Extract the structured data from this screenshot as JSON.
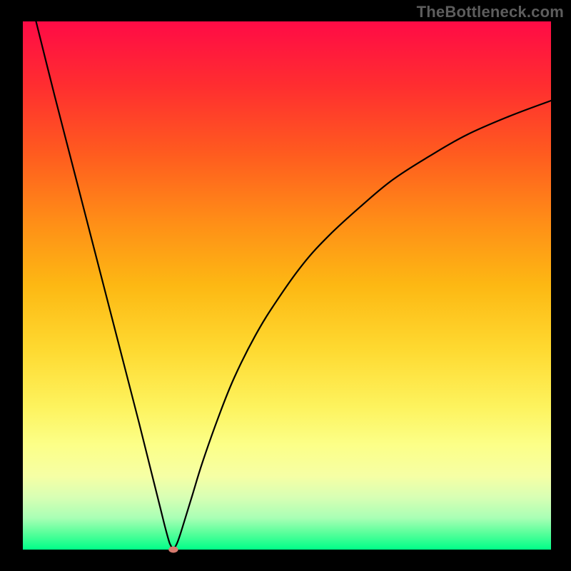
{
  "watermark": "TheBottleneck.com",
  "chart_data": {
    "type": "line",
    "title": "",
    "xlabel": "",
    "ylabel": "",
    "xlim": [
      0,
      100
    ],
    "ylim": [
      0,
      100
    ],
    "series": [
      {
        "name": "left-branch",
        "x": [
          2.5,
          6,
          10,
          14,
          18,
          22,
          24,
          26,
          27,
          27.8,
          28.5
        ],
        "y": [
          100,
          86,
          70.5,
          55,
          39.5,
          24,
          16,
          8,
          4,
          1.2,
          0
        ]
      },
      {
        "name": "right-branch",
        "x": [
          28.5,
          29.2,
          30,
          32,
          34,
          37,
          40,
          44,
          48,
          53,
          58,
          64,
          70,
          77,
          84,
          92,
          100
        ],
        "y": [
          0,
          1.2,
          3.5,
          10,
          16.5,
          25,
          32.5,
          40.5,
          47,
          54,
          59.5,
          65,
          70,
          74.5,
          78.5,
          82,
          85
        ]
      }
    ],
    "marker": {
      "x": 28.5,
      "y": 0,
      "rx": 0.9,
      "ry": 0.6,
      "color": "#d67a6e"
    },
    "background_gradient": {
      "top": "#ff0b46",
      "bottom": "#00ff88"
    }
  }
}
